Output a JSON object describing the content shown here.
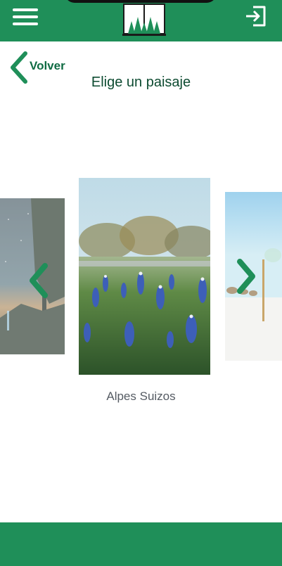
{
  "header": {
    "menu_icon": "hamburger-menu-icon",
    "logo_icon": "book-forest-logo",
    "exit_icon": "sign-out-icon",
    "color": "#1f8f59"
  },
  "nav": {
    "back_label": "Volver"
  },
  "page": {
    "title": "Elige un paisaje"
  },
  "carousel": {
    "selected_caption": "Alpes Suizos",
    "items": [
      {
        "scene": "night-forest-stars",
        "icon": "landscape-image"
      },
      {
        "scene": "bluebonnet-field",
        "icon": "landscape-image"
      },
      {
        "scene": "white-beach",
        "icon": "landscape-image"
      }
    ],
    "prev_icon": "chevron-left-icon",
    "next_icon": "chevron-right-icon",
    "arrow_color": "#1f8f59"
  }
}
